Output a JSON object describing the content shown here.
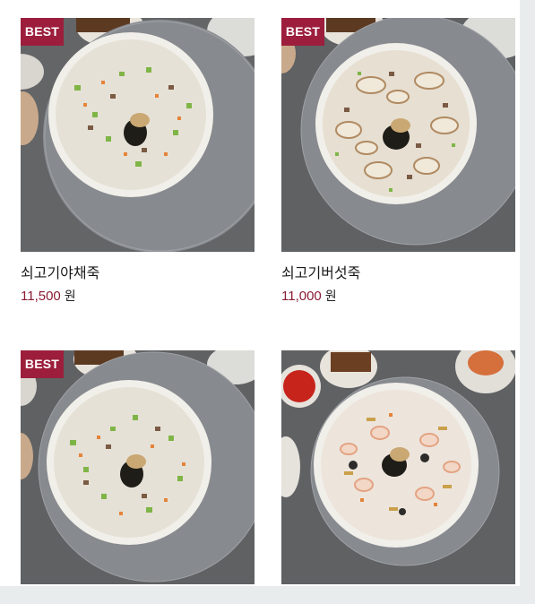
{
  "products": [
    {
      "badge": "BEST",
      "name": "쇠고기야채죽",
      "price": "11,500",
      "currency": "원",
      "image": "beef-vegetable-porridge-photo"
    },
    {
      "badge": "BEST",
      "name": "쇠고기버섯죽",
      "price": "11,000",
      "currency": "원",
      "image": "beef-mushroom-porridge-photo"
    },
    {
      "badge": "BEST",
      "name": "",
      "price": "",
      "currency": "",
      "image": "vegetable-porridge-photo"
    },
    {
      "badge": "",
      "name": "",
      "price": "",
      "currency": "",
      "image": "seafood-porridge-photo"
    }
  ],
  "colors": {
    "badge_bg": "#9c1e3c",
    "price_text": "#8b1c35",
    "page_bg": "#e9ecec"
  }
}
